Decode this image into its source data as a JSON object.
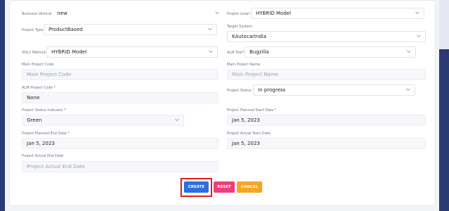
{
  "form": {
    "business_vertical": {
      "label": "Business Vertical *",
      "value": "new"
    },
    "project_level": {
      "label": "Project Level *",
      "value": "HYBRID Model"
    },
    "project_type": {
      "label": "Project Type *",
      "value": "ProductBased"
    },
    "target_system": {
      "label": "Target System",
      "value": "KAutocarIndia"
    },
    "sdlc_method": {
      "label": "SDLC Method *",
      "value": "HYBRID Model"
    },
    "alm_tool": {
      "label": "ALM Tool*",
      "value": "Bugzilla"
    },
    "main_project_code": {
      "label": "Main Project Code",
      "placeholder": "Main Project Code"
    },
    "main_project_name": {
      "label": "Main Project Name",
      "placeholder": "Main Project Name"
    },
    "alm_project_code": {
      "label": "ALM Project Code *",
      "value": "None"
    },
    "project_status": {
      "label": "Project Status *",
      "value": "In progress"
    },
    "project_status_indicator": {
      "label": "Project Status Indicator *",
      "value": "Green"
    },
    "project_planned_start_date": {
      "label": "Project Planned Start Date *",
      "value": "Jan 5, 2023"
    },
    "project_planned_end_date": {
      "label": "Project Planned End Date *",
      "value": "Jan 5, 2023"
    },
    "project_actual_start_date": {
      "label": "Project Actual Start Date",
      "value": "Jan 5, 2023"
    },
    "project_actual_end_date": {
      "label": "Project Actual End Date",
      "placeholder": "Project Actual End Date"
    }
  },
  "buttons": {
    "create": "CREATE",
    "reset": "RESET",
    "cancel": "CANCEL"
  },
  "colors": {
    "create": "#2f6de1",
    "reset": "#ef3f7a",
    "cancel": "#f5a623",
    "sidebar": "#2c3a74",
    "highlight": "#e01e1e"
  }
}
